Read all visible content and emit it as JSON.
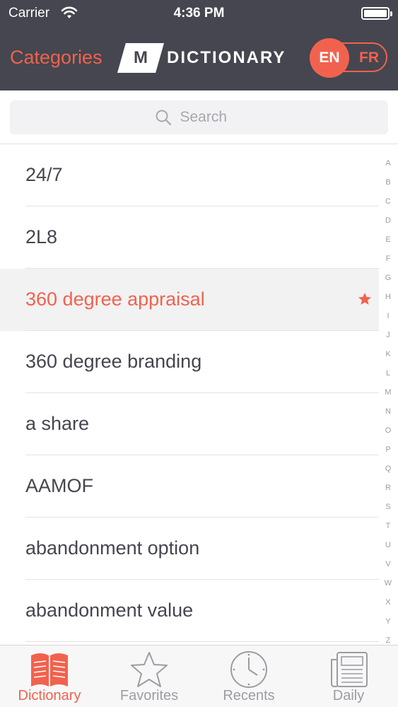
{
  "status_bar": {
    "carrier": "Carrier",
    "time": "4:36 PM"
  },
  "nav": {
    "categories_label": "Categories",
    "logo_mark": "M",
    "logo_word": "DICTIONARY",
    "lang_active": "EN",
    "lang_inactive": "FR"
  },
  "search": {
    "placeholder": "Search"
  },
  "entries": [
    {
      "label": "24/7",
      "favorite": false,
      "selected": false
    },
    {
      "label": "2L8",
      "favorite": false,
      "selected": false
    },
    {
      "label": "360 degree appraisal",
      "favorite": true,
      "selected": true
    },
    {
      "label": "360 degree branding",
      "favorite": false,
      "selected": false
    },
    {
      "label": "a share",
      "favorite": false,
      "selected": false
    },
    {
      "label": "AAMOF",
      "favorite": false,
      "selected": false
    },
    {
      "label": "abandonment option",
      "favorite": false,
      "selected": false
    },
    {
      "label": "abandonment value",
      "favorite": false,
      "selected": false
    }
  ],
  "alpha_index": [
    "A",
    "B",
    "C",
    "D",
    "E",
    "F",
    "G",
    "H",
    "I",
    "J",
    "K",
    "L",
    "M",
    "N",
    "O",
    "P",
    "Q",
    "R",
    "S",
    "T",
    "U",
    "V",
    "W",
    "X",
    "Y",
    "Z"
  ],
  "tabs": [
    {
      "label": "Dictionary",
      "icon": "book-icon",
      "active": true
    },
    {
      "label": "Favorites",
      "icon": "star-icon",
      "active": false
    },
    {
      "label": "Recents",
      "icon": "clock-icon",
      "active": false
    },
    {
      "label": "Daily",
      "icon": "newspaper-icon",
      "active": false
    }
  ],
  "colors": {
    "accent": "#f1624e",
    "header_bg": "#45464f",
    "text": "#45464f",
    "muted": "#9c9da3"
  }
}
